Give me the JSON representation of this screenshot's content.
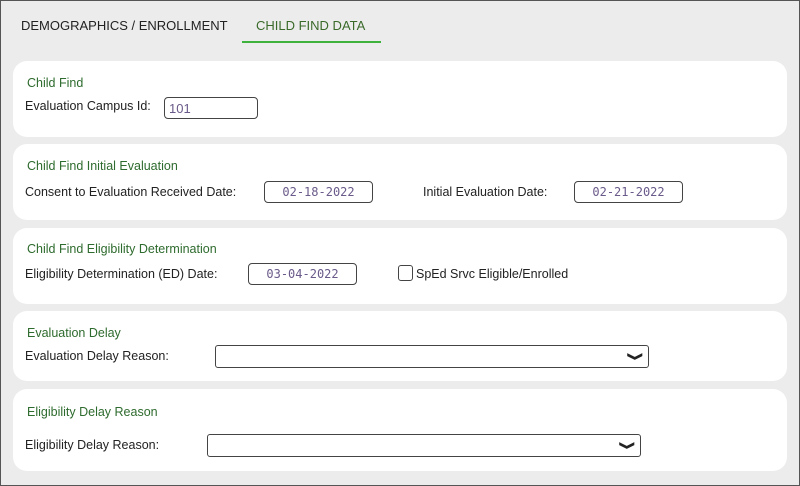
{
  "tabs": [
    {
      "label": "DEMOGRAPHICS / ENROLLMENT",
      "active": false
    },
    {
      "label": "CHILD FIND DATA",
      "active": true
    }
  ],
  "child_find": {
    "title": "Child Find",
    "campus_label": "Evaluation Campus Id:",
    "campus_value": "101"
  },
  "initial_eval": {
    "title": "Child Find Initial Evaluation",
    "consent_label": "Consent to Evaluation Received Date:",
    "consent_value": "02-18-2022",
    "initial_label": "Initial Evaluation Date:",
    "initial_value": "02-21-2022"
  },
  "eligibility": {
    "title": "Child Find Eligibility Determination",
    "ed_label": "Eligibility Determination (ED) Date:",
    "ed_value": "03-04-2022",
    "sped_label": "SpEd Srvc Eligible/Enrolled",
    "sped_checked": false
  },
  "eval_delay": {
    "title": "Evaluation Delay",
    "reason_label": "Evaluation Delay Reason:",
    "reason_value": ""
  },
  "elig_delay": {
    "title": "Eligibility Delay Reason",
    "reason_label": "Eligibility Delay Reason:",
    "reason_value": ""
  },
  "colors": {
    "accent": "#3db33d",
    "title": "#2e6b2e"
  }
}
